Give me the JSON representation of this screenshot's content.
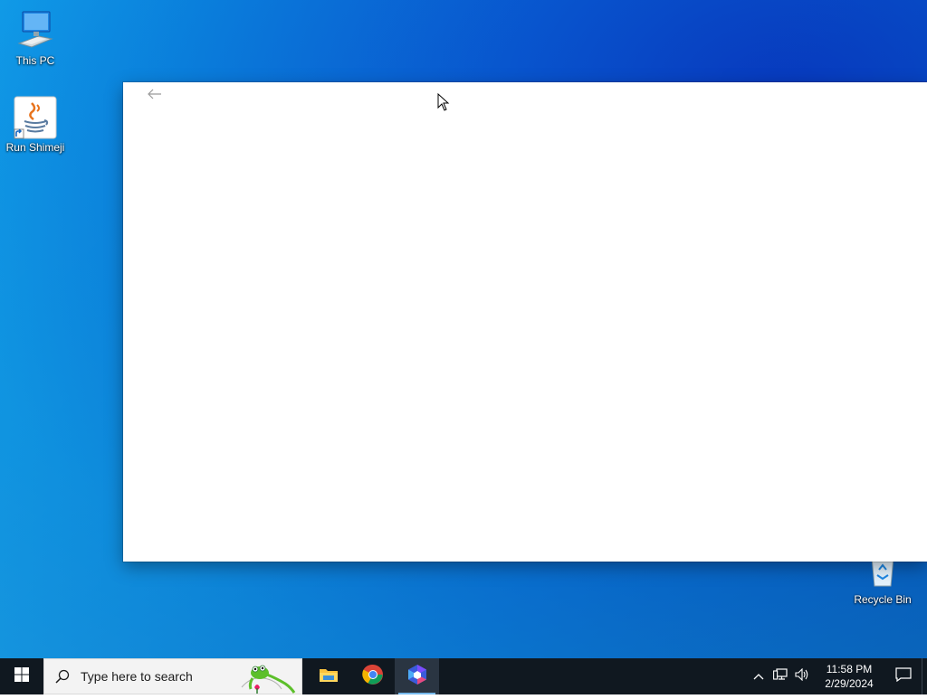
{
  "desktop": {
    "icons": [
      {
        "label": "This PC",
        "icon": "this-pc-icon"
      },
      {
        "label": "Run Shimeji",
        "icon": "java-shortcut-icon"
      },
      {
        "label": "Recycle Bin",
        "icon": "recycle-bin-icon"
      }
    ]
  },
  "window": {
    "back_icon": "back-arrow-icon",
    "background": "#ffffff"
  },
  "taskbar": {
    "search_placeholder": "Type here to search",
    "apps": [
      {
        "name": "File Explorer",
        "icon": "file-explorer-icon"
      },
      {
        "name": "Google Chrome",
        "icon": "chrome-icon"
      },
      {
        "name": "Active app",
        "icon": "app-logo-icon",
        "active": true
      }
    ],
    "clock": {
      "time": "11:58 PM",
      "date": "2/29/2024"
    },
    "colors": {
      "taskbar_bg": "#101820",
      "active_app_bg": "#2a3542",
      "running_indicator": "#76b9ed"
    }
  }
}
